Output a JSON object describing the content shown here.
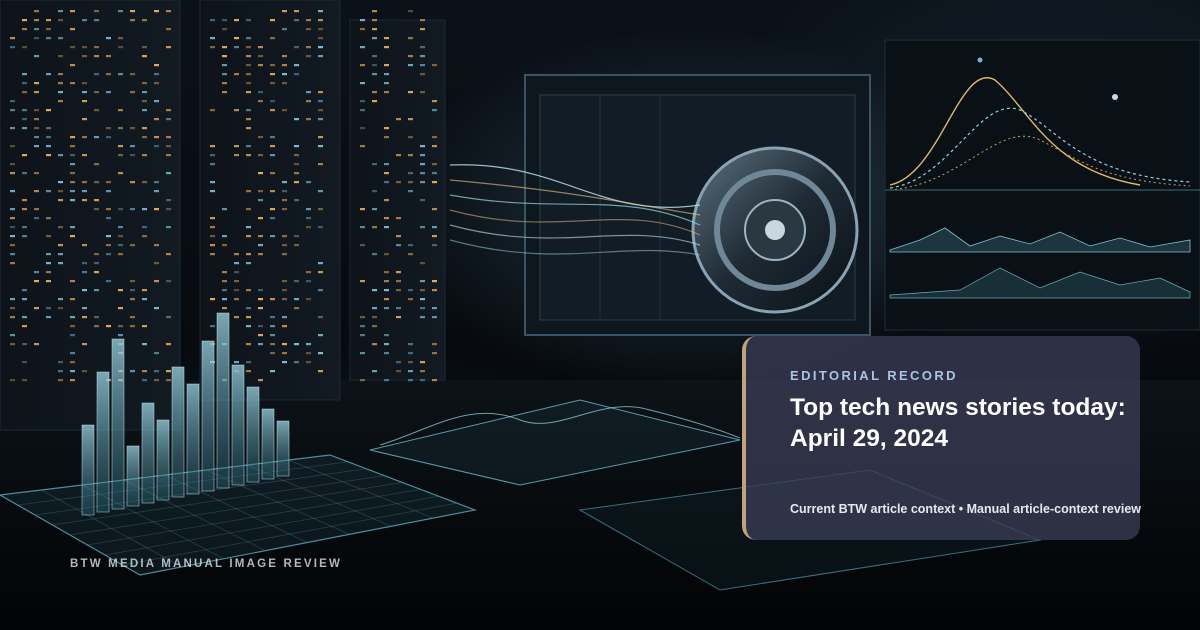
{
  "card": {
    "eyebrow": "EDITORIAL RECORD",
    "title": "Top tech news stories today: April 29, 2024",
    "subline": "Current BTW article context • Manual article-context review"
  },
  "image_caption": "BTW MEDIA MANUAL IMAGE REVIEW",
  "colors": {
    "card_background": "#3a3c54",
    "card_accent": "#c1a27a",
    "eyebrow": "#a9c4e3",
    "headline": "#ffffff"
  }
}
